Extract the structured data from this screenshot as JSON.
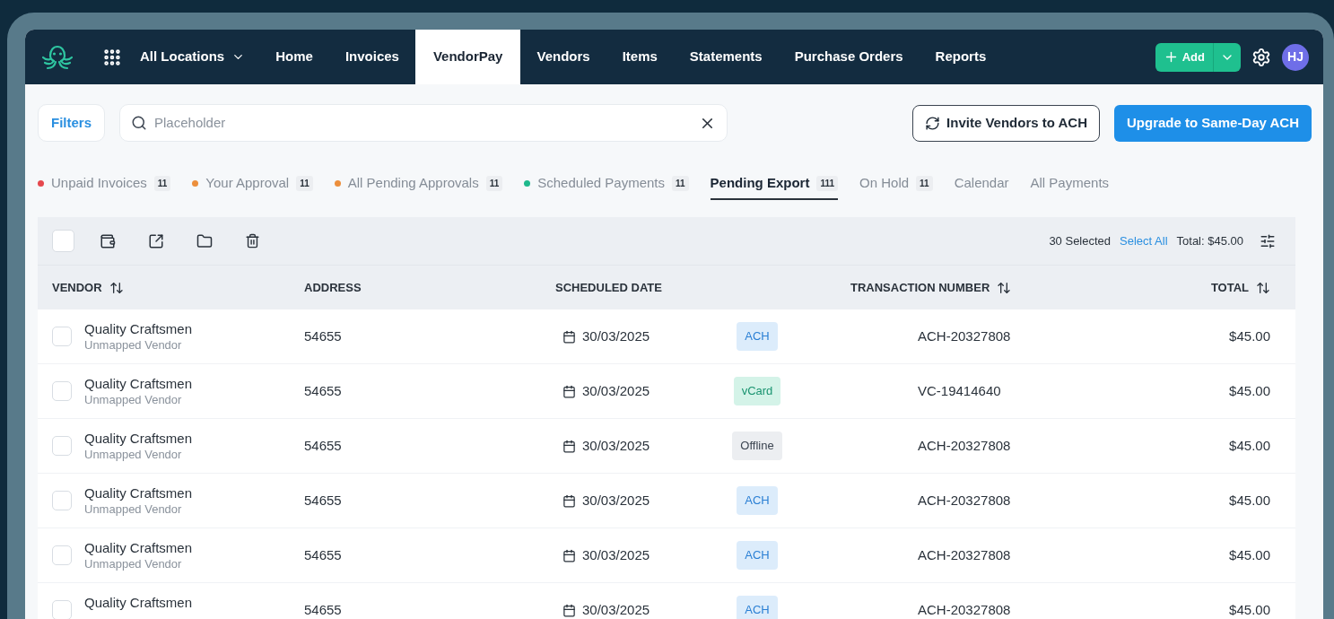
{
  "nav": {
    "locations": "All Locations",
    "items": [
      {
        "label": "Home",
        "selected": false
      },
      {
        "label": "Invoices",
        "selected": false
      },
      {
        "label": "VendorPay",
        "selected": true
      },
      {
        "label": "Vendors",
        "selected": false
      },
      {
        "label": "Items",
        "selected": false
      },
      {
        "label": "Statements",
        "selected": false
      },
      {
        "label": "Purchase Orders",
        "selected": false
      },
      {
        "label": "Reports",
        "selected": false
      }
    ],
    "add_button": "Add",
    "avatar": "HJ"
  },
  "toolbar": {
    "filters": "Filters",
    "search": {
      "placeholder": "Placeholder"
    },
    "invite_button": "Invite Vendors to ACH",
    "upgrade_button": "Upgrade to Same-Day ACH"
  },
  "tabs": [
    {
      "label": "Unpaid Invoices",
      "count": "11",
      "color": "#e5484d",
      "selected": false
    },
    {
      "label": "Your Approval",
      "count": "11",
      "color": "#ec8f3c",
      "selected": false
    },
    {
      "label": "All Pending Approvals",
      "count": "11",
      "color": "#ec8f3c",
      "selected": false
    },
    {
      "label": "Scheduled Payments",
      "count": "11",
      "color": "#1fb98c",
      "selected": false
    },
    {
      "label": "Pending Export",
      "count": "111",
      "selected": true
    },
    {
      "label": "On Hold",
      "count": "11",
      "selected": false
    },
    {
      "label": "Calendar",
      "selected": false
    },
    {
      "label": "All Payments",
      "selected": false
    }
  ],
  "bulk_bar": {
    "checked": false,
    "selected_count": "30 Selected",
    "select_all": "Select All",
    "total": "Total: $45.00"
  },
  "table": {
    "columns": [
      {
        "label": "VENDOR",
        "sortable": true
      },
      {
        "label": "ADDRESS",
        "sortable": false
      },
      {
        "label": "SCHEDULED DATE",
        "sortable": false
      },
      {
        "label": "TRANSACTION NUMBER",
        "sortable": true
      },
      {
        "label": "TOTAL",
        "sortable": true
      }
    ],
    "rows": [
      {
        "checked": false,
        "vendor": "Quality Craftsmen",
        "status": "Unmapped Vendor",
        "address": "54655",
        "date": "30/03/2025",
        "method": {
          "kind": "ach",
          "label": "ACH"
        },
        "transaction": "ACH-20327808",
        "total": "$45.00"
      },
      {
        "checked": false,
        "vendor": "Quality Craftsmen",
        "status": "Unmapped Vendor",
        "address": "54655",
        "date": "30/03/2025",
        "method": {
          "kind": "vcard",
          "label": "vCard"
        },
        "transaction": "VC-19414640",
        "total": "$45.00"
      },
      {
        "checked": false,
        "vendor": "Quality Craftsmen",
        "status": "Unmapped Vendor",
        "address": "54655",
        "date": "30/03/2025",
        "method": {
          "kind": "offline",
          "label": "Offline"
        },
        "transaction": "ACH-20327808",
        "total": "$45.00"
      },
      {
        "checked": false,
        "vendor": "Quality Craftsmen",
        "status": "Unmapped Vendor",
        "address": "54655",
        "date": "30/03/2025",
        "method": {
          "kind": "ach",
          "label": "ACH"
        },
        "transaction": "ACH-20327808",
        "total": "$45.00"
      },
      {
        "checked": false,
        "vendor": "Quality Craftsmen",
        "status": "Unmapped Vendor",
        "address": "54655",
        "date": "30/03/2025",
        "method": {
          "kind": "ach",
          "label": "ACH"
        },
        "transaction": "ACH-20327808",
        "total": "$45.00"
      },
      {
        "checked": false,
        "vendor": "Quality Craftsmen",
        "address": "54655",
        "date": "30/03/2025",
        "method": {
          "kind": "ach",
          "label": "ACH"
        },
        "transaction": "ACH-20327808",
        "total": "$45.00"
      }
    ]
  }
}
